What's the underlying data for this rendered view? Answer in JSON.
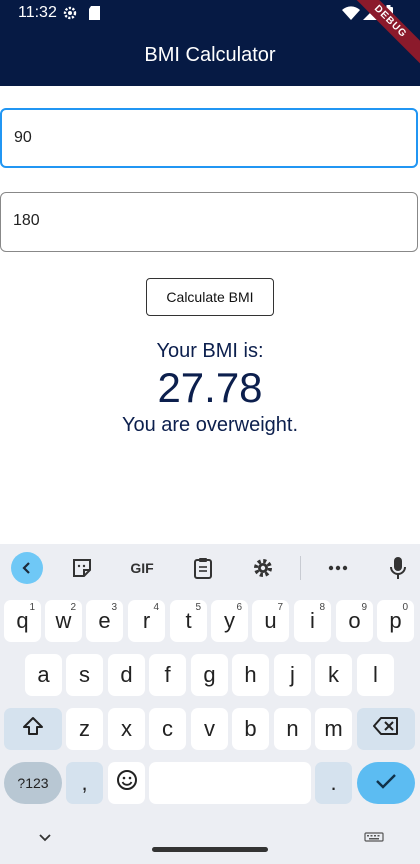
{
  "status_bar": {
    "time": "11:32",
    "icons": [
      "settings-icon",
      "sd-card-icon",
      "wifi-icon",
      "signal-icon",
      "battery-icon"
    ]
  },
  "app_bar": {
    "title": "BMI Calculator",
    "debug_banner": "DEBUG",
    "color": "#061a44"
  },
  "weight_field": {
    "value": "90"
  },
  "height_field": {
    "value": "180"
  },
  "calculate_button": {
    "label": "Calculate BMI"
  },
  "result": {
    "label": "Your BMI is:",
    "value": "27.78",
    "message": "You are overweight.",
    "color": "#0c1f4d"
  },
  "keyboard": {
    "toolbar": {
      "gif_label": "GIF",
      "items": [
        "back-icon",
        "sticker-icon",
        "gif-icon",
        "clipboard-icon",
        "settings-icon",
        "more-icon",
        "mic-icon"
      ]
    },
    "row1": [
      {
        "key": "q",
        "hint": "1"
      },
      {
        "key": "w",
        "hint": "2"
      },
      {
        "key": "e",
        "hint": "3"
      },
      {
        "key": "r",
        "hint": "4"
      },
      {
        "key": "t",
        "hint": "5"
      },
      {
        "key": "y",
        "hint": "6"
      },
      {
        "key": "u",
        "hint": "7"
      },
      {
        "key": "i",
        "hint": "8"
      },
      {
        "key": "o",
        "hint": "9"
      },
      {
        "key": "p",
        "hint": "0"
      }
    ],
    "row2": [
      "a",
      "s",
      "d",
      "f",
      "g",
      "h",
      "j",
      "k",
      "l"
    ],
    "row3": [
      "z",
      "x",
      "c",
      "v",
      "b",
      "n",
      "m"
    ],
    "row4": {
      "symbols": "?123",
      "comma": ",",
      "period": "."
    },
    "accent_color": "#5cbcf2"
  }
}
